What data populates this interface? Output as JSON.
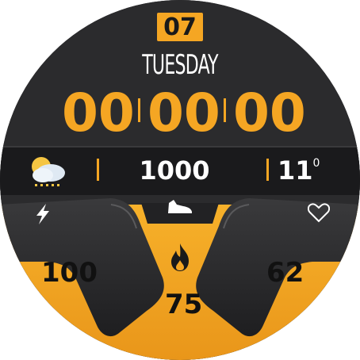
{
  "date": {
    "day": "07",
    "weekday": "TUESDAY"
  },
  "time": {
    "hours": "00",
    "minutes": "00",
    "seconds": "00"
  },
  "info_bar": {
    "weather_icon": "cloudy-night-icon",
    "steps": "1000",
    "temperature": "11",
    "temperature_unit": "0"
  },
  "stats": {
    "battery": {
      "icon": "lightning-icon",
      "value": "100"
    },
    "calories": {
      "icon": "fire-icon",
      "value": "75"
    },
    "heart_rate": {
      "icon": "heart-icon",
      "value": "62"
    },
    "steps_icon": "shoe-icon"
  },
  "colors": {
    "accent": "#f5a623",
    "background": "#2a2a2c",
    "band": "#1c1c1e",
    "text": "#ffffff"
  }
}
